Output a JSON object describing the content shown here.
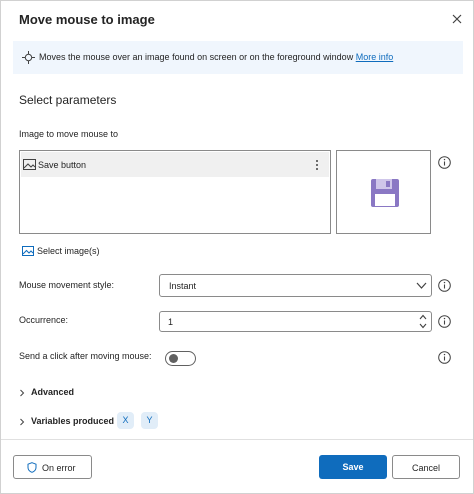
{
  "dialog": {
    "title": "Move mouse to image",
    "close_icon": "close-icon"
  },
  "info": {
    "icon": "mouse-pointer-icon",
    "text": "Moves the mouse over an image found on screen or on the foreground window",
    "link": "More info"
  },
  "params": {
    "section_title": "Select parameters",
    "image_label": "Image to move mouse to",
    "images": [
      {
        "label": "Save button",
        "icon": "image-icon"
      }
    ],
    "preview_icon": "floppy-disk-icon",
    "select_image_label": "Select image(s)",
    "movement_label": "Mouse movement style:",
    "movement_value": "Instant",
    "occurrence_label": "Occurrence:",
    "occurrence_value": "1",
    "click_label": "Send a click after moving mouse:",
    "click_enabled": false
  },
  "advanced": {
    "label": "Advanced"
  },
  "variables": {
    "label": "Variables produced",
    "items": [
      "X",
      "Y"
    ]
  },
  "footer": {
    "on_error_label": "On error",
    "save_label": "Save",
    "cancel_label": "Cancel"
  },
  "colors": {
    "accent": "#0f6cbd",
    "info_bg": "#f0f6fd",
    "floppy": "#8a78c4"
  }
}
